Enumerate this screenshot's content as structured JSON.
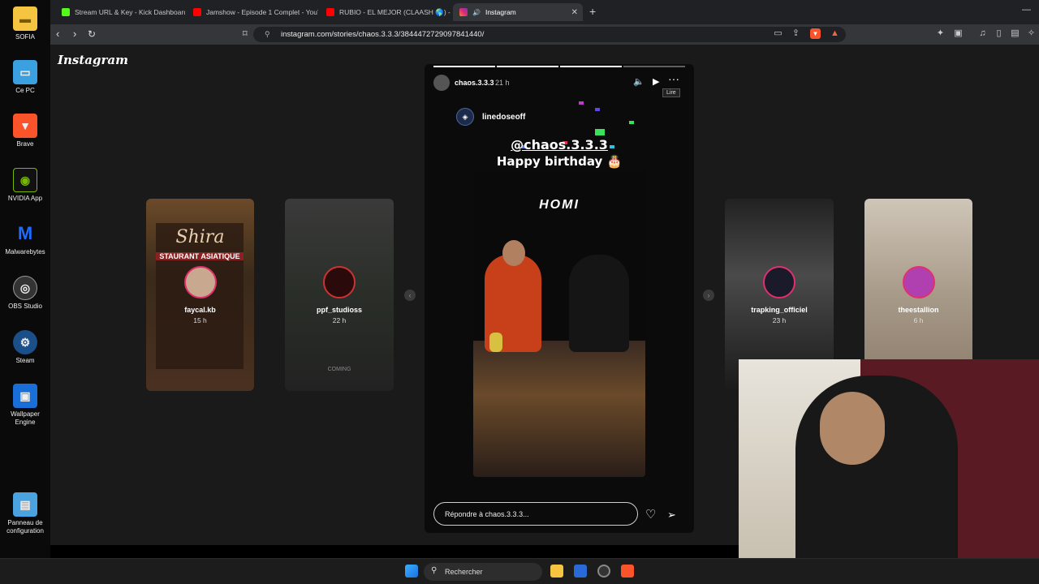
{
  "desktop": {
    "icons": [
      {
        "label": "SOFIA",
        "icon": "folder-icon",
        "color": "#f5c542"
      },
      {
        "label": "Ce PC",
        "icon": "computer-icon",
        "color": "#3aa0e0"
      },
      {
        "label": "Brave",
        "icon": "brave-icon",
        "color": "#fb542b"
      },
      {
        "label": "NVIDIA App",
        "icon": "nvidia-icon",
        "color": "#76b900"
      },
      {
        "label": "Malwarebytes",
        "icon": "malwarebytes-icon",
        "color": "#1e6bff"
      },
      {
        "label": "OBS Studio",
        "icon": "obs-icon",
        "color": "#333333"
      },
      {
        "label": "Steam",
        "icon": "steam-icon",
        "color": "#1b4f8a"
      },
      {
        "label": "Wallpaper Engine",
        "icon": "wallpaper-engine-icon",
        "color": "#1a6ed8"
      },
      {
        "label": "Panneau de configuration",
        "icon": "control-panel-icon",
        "color": "#4aa3df"
      }
    ]
  },
  "browser": {
    "tabs": [
      {
        "label": "Stream URL & Key - Kick Dashboard",
        "color": "#53fc18"
      },
      {
        "label": "Jamshow - Episode 1 Complet - YouT",
        "color": "#ff0000"
      },
      {
        "label": "RUBIO - EL MEJOR (CLAASH 🌎) - Yo",
        "color": "#ff0000"
      },
      {
        "label": "Instagram",
        "color": "#e1306c"
      }
    ],
    "new_tab": "+",
    "url": "instagram.com/stories/chaos.3.3.3/3844472729097841440/"
  },
  "instagram": {
    "logo": "Instagram",
    "side_stories": [
      {
        "user": "faycal.kb",
        "time": "15 h",
        "header_text": "Shira",
        "subtext": "STAURANT ASIATIQUE"
      },
      {
        "user": "ppf_studioss",
        "time": "22 h",
        "caption": "COMING"
      },
      {
        "user": "trapking_officiel",
        "time": "23 h"
      },
      {
        "user": "theestallion",
        "time": "6 h"
      }
    ],
    "story": {
      "user": "chaos.3.3.3",
      "time": "21 h",
      "tooltip": "Lire",
      "repost_user": "linedoseoff",
      "mention": "@chaos.3.3.3",
      "birthday_text": "Happy birthday 🎂",
      "video_title": "HOMI",
      "progress_segments": 4,
      "progress_done": 3,
      "reply_placeholder": "Répondre à chaos.3.3.3..."
    }
  },
  "taskbar": {
    "search_placeholder": "Rechercher"
  }
}
